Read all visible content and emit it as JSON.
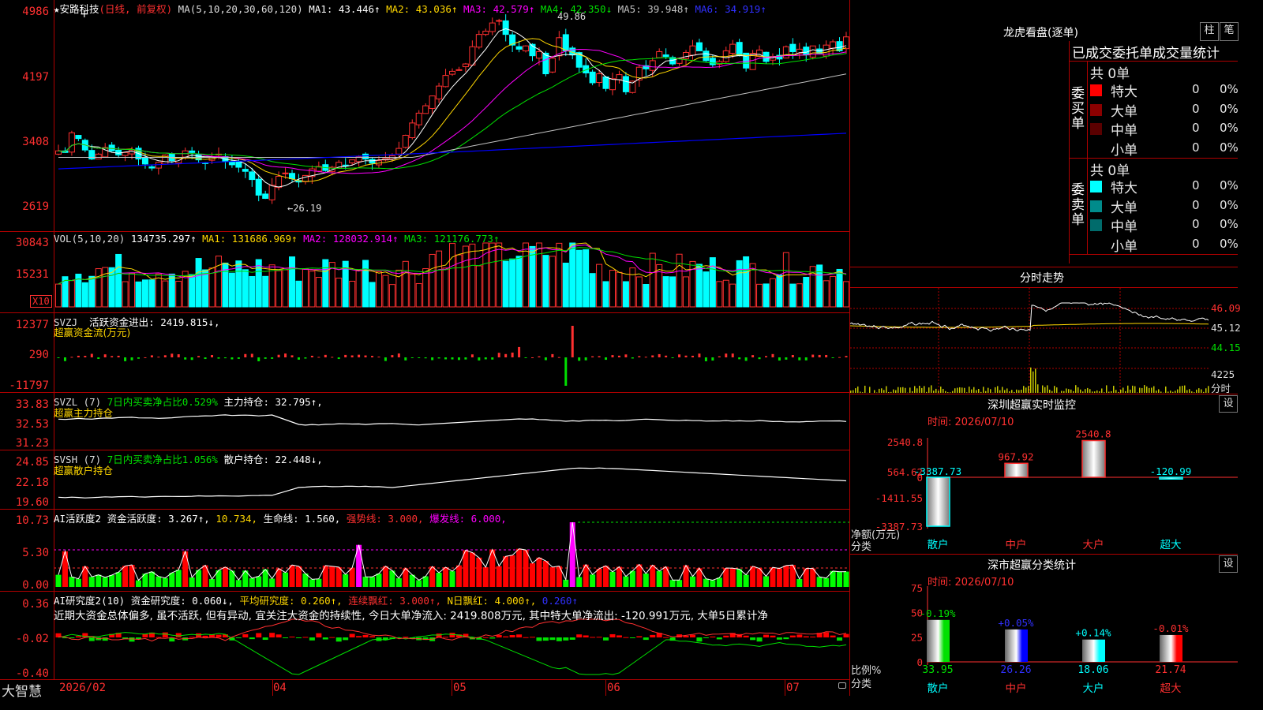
{
  "app": {
    "logo": "大智慧",
    "lock_icon": "lock-icon"
  },
  "colors": {
    "up": "#ff3030",
    "down": "#00ffff",
    "border": "#b00000",
    "ma1": "#ffffff",
    "ma2": "#ffd700",
    "ma3": "#ff00ff",
    "ma4": "#00e000",
    "ma5": "#c0c0c0",
    "ma6": "#0000ff"
  },
  "price_panel": {
    "title_prefix": "★安路科技",
    "period": "(日线, 前复权)",
    "ma_label": "MA(5,10,20,30,60,120)",
    "ma1": "MA1: 43.446↑",
    "ma2": "MA2: 43.036↑",
    "ma3": "MA3: 42.579↑",
    "ma4": "MA4: 42.350↓",
    "ma5": "MA5: 39.948↑",
    "ma6": "MA6: 34.919↑",
    "y_labels": [
      "4986",
      "4197",
      "3408",
      "2619"
    ],
    "high_mark": "49.86",
    "low_mark": "←26.19"
  },
  "vol_panel": {
    "title": "VOL(5,10,20)",
    "value": "134735.297↑",
    "ma1": "MA1: 131686.969↑",
    "ma2": "MA2: 128032.914↑",
    "ma3": "MA3: 121176.773↑",
    "y_labels": [
      "30843",
      "15231"
    ],
    "unit": "X10"
  },
  "svzj_panel": {
    "title": "SVZJ",
    "label": "活跃资金进出: 2419.815↓,",
    "subtitle": "超赢资金流(万元)",
    "y_labels": [
      "12377",
      "290",
      "-11797"
    ]
  },
  "svzl_panel": {
    "title": "SVZL (7)",
    "label1": "7日内买卖净占比0.529%",
    "label2": "主力持仓: 32.795↑,",
    "subtitle": "超赢主力持仓",
    "y_labels": [
      "33.83",
      "32.53",
      "31.23"
    ]
  },
  "svsh_panel": {
    "title": "SVSH (7)",
    "label1": "7日内买卖净占比1.056%",
    "label2": "散户持仓: 22.448↓,",
    "subtitle": "超赢散户持仓",
    "y_labels": [
      "24.85",
      "22.18",
      "19.60"
    ]
  },
  "ai2_panel": {
    "title": "AI活跃度2 资金活跃度: 3.267↑,",
    "v1": "10.734,",
    "v2": "生命线: 1.560,",
    "v3": "强势线: 3.000,",
    "v4": "爆发线: 6.000,",
    "y_labels": [
      "10.73",
      "5.30",
      "0.00"
    ]
  },
  "ai_research_panel": {
    "title": "AI研究度2(10) 资金研究度: 0.060↓,",
    "avg": "平均研究度: 0.260↑,",
    "streak": "连续飘红: 3.000↑,",
    "nday": "N日飘红: 4.000↑,",
    "last": "0.260↑",
    "comment": "近期大资金总体偏多, 虽不活跃, 但有异动, 宜关注大资金的持续性, 今日大单净流入: 2419.808万元, 其中特大单净流出: -120.991万元, 大单5日累计净",
    "y_labels": [
      "0.36",
      "-0.02",
      "-0.40"
    ]
  },
  "time_axis": [
    "2026/02",
    "04",
    "05",
    "06",
    "07"
  ],
  "dragon_tiger": {
    "title": "龙虎看盘(逐单)",
    "btn_col": "柱",
    "btn_stroke": "笔",
    "header": "已成交委托单成交量统计",
    "buy_label": "委买单",
    "sell_label": "委卖单",
    "buy_total": "共 0单",
    "sell_total": "共 0单",
    "buy_rows": [
      {
        "name": "特大",
        "value": "0",
        "pct": "0%",
        "color": "#ff0000"
      },
      {
        "name": "大单",
        "value": "0",
        "pct": "0%",
        "color": "#8b0000"
      },
      {
        "name": "中单",
        "value": "0",
        "pct": "0%",
        "color": "#5a0000"
      },
      {
        "name": "小单",
        "value": "0",
        "pct": "0%",
        "color": "#000000"
      }
    ],
    "sell_rows": [
      {
        "name": "特大",
        "value": "0",
        "pct": "0%",
        "color": "#00ffff"
      },
      {
        "name": "大单",
        "value": "0",
        "pct": "0%",
        "color": "#008b8b"
      },
      {
        "name": "中单",
        "value": "0",
        "pct": "0%",
        "color": "#006b6b"
      },
      {
        "name": "小单",
        "value": "0",
        "pct": "0%",
        "color": "#000000"
      }
    ]
  },
  "intraday": {
    "title": "分时走势",
    "price_labels": [
      "46.09",
      "45.12",
      "44.15"
    ],
    "vol_label": "4225",
    "unit": "分时"
  },
  "sz_monitor": {
    "title": "深圳超赢实时监控",
    "set": "设",
    "time": "时间: 2026/07/10",
    "y_labels": [
      "2540.8",
      "564.62",
      "0",
      "-1411.55",
      "-3387.73"
    ],
    "ylabel1": "净额(万元)",
    "ylabel2": "分类",
    "categories": [
      "散户",
      "中户",
      "大户",
      "超大"
    ],
    "values": [
      -3387.73,
      967.92,
      2540.8,
      -120.99
    ],
    "value_labels": [
      "-3387.73",
      "967.92",
      "2540.8",
      "-120.99"
    ]
  },
  "sz_stats": {
    "title": "深市超赢分类统计",
    "set": "设",
    "time": "时间: 2026/07/10",
    "y_labels": [
      "75",
      "50",
      "25",
      "0"
    ],
    "ylabel1": "比例%",
    "ylabel2": "分类",
    "categories": [
      "散户",
      "中户",
      "大户",
      "超大"
    ],
    "values": [
      33.95,
      26.26,
      18.06,
      21.74
    ],
    "value_labels": [
      "33.95",
      "26.26",
      "18.06",
      "21.74"
    ],
    "change_labels": [
      "-0.19%",
      "+0.05%",
      "+0.14%",
      "-0.01%"
    ]
  },
  "chart_data": [
    {
      "type": "candlestick",
      "title": "★安路科技 (日线, 前复权)",
      "ylim": [
        26.19,
        49.86
      ],
      "y_ticks": [
        49.86,
        41.97,
        34.08,
        26.19
      ],
      "x_ticks": [
        "2026/02",
        "04",
        "05",
        "06",
        "07"
      ],
      "series": [
        {
          "name": "MA1",
          "last": 43.446
        },
        {
          "name": "MA2",
          "last": 43.036
        },
        {
          "name": "MA3",
          "last": 42.579
        },
        {
          "name": "MA4",
          "last": 42.35
        },
        {
          "name": "MA5",
          "last": 39.948
        },
        {
          "name": "MA6",
          "last": 34.919
        }
      ],
      "close": [
        33.0,
        32.8,
        35.2,
        34.5,
        33.1,
        32.0,
        32.6,
        33.4,
        33.0,
        32.5,
        32.8,
        33.1,
        32.0,
        31.4,
        30.9,
        31.6,
        32.5,
        31.8,
        32.2,
        33.0,
        32.8,
        31.9,
        31.5,
        32.2,
        32.6,
        31.7,
        31.3,
        31.0,
        30.5,
        29.5,
        27.6,
        27.2,
        28.8,
        29.9,
        30.3,
        29.6,
        29.2,
        30.0,
        30.8,
        31.1,
        30.6,
        31.0,
        31.6,
        31.2,
        31.9,
        32.3,
        32.0,
        31.5,
        31.8,
        32.1,
        32.4,
        33.3,
        34.9,
        36.4,
        37.6,
        38.5,
        39.7,
        40.9,
        42.2,
        42.7,
        42.9,
        43.6,
        45.7,
        47.2,
        47.6,
        48.6,
        48.9,
        47.2,
        45.9,
        45.4,
        45.8,
        44.6,
        45.1,
        42.4,
        44.3,
        46.8,
        45.2,
        44.7,
        43.2,
        42.5,
        41.3,
        42.4,
        40.6,
        41.8,
        42.3,
        40.2,
        41.5,
        43.2,
        43.0,
        44.0,
        45.1,
        44.5,
        43.6,
        44.3,
        45.0,
        45.8,
        45.2,
        44.0,
        43.5,
        43.9,
        45.2,
        46.0,
        44.6,
        43.1,
        44.9,
        45.3,
        43.9,
        44.5,
        44.2,
        45.7,
        45.1,
        45.4,
        44.7,
        45.8,
        44.9,
        45.9,
        46.3,
        45.2,
        46.9
      ],
      "volume_ticks": [
        30843,
        15231
      ]
    },
    {
      "type": "bar",
      "title": "超赢资金流(万元)",
      "ylim": [
        -11797,
        12377
      ],
      "last": 2419.815
    },
    {
      "type": "bar",
      "title": "超赢分类统计",
      "categories": [
        "散户",
        "中户",
        "大户",
        "超大"
      ],
      "values": [
        33.95,
        26.26,
        18.06,
        21.74
      ],
      "ylim": [
        0,
        75
      ]
    }
  ]
}
